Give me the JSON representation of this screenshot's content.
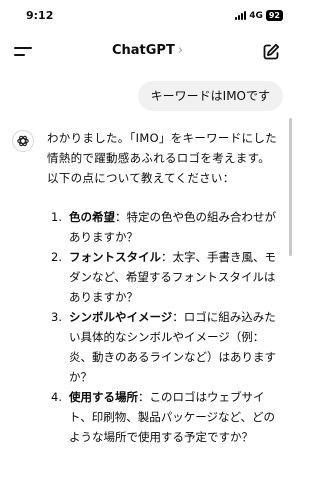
{
  "status_bar": {
    "time": "9:12",
    "network": "4G",
    "battery": "92"
  },
  "header": {
    "title": "ChatGPT",
    "title_chevron": "›",
    "menu_icon": "menu-icon",
    "compose_icon": "compose-icon"
  },
  "conversation": {
    "user_message": "キーワードはIMOです",
    "assistant_icon": "openai-logo-icon",
    "assistant_intro": "わかりました。「IMO」をキーワードにした情熱的で躍動感あふれるロゴを考えます。以下の点について教えてください：",
    "points": [
      {
        "number": "1.",
        "title": "色の希望",
        "body": "：特定の色や色の組み合わせがありますか？"
      },
      {
        "number": "2.",
        "title": "フォントスタイル",
        "body": "：太字、手書き風、モダンなど、希望するフォントスタイルはありますか？"
      },
      {
        "number": "3.",
        "title": "シンボルやイメージ",
        "body": "：ロゴに組み込みたい具体的なシンボルやイメージ（例：炎、動きのあるラインなど）はありますか？"
      },
      {
        "number": "4.",
        "title": "使用する場所",
        "body": "：このロゴはウェブサイト、印刷物、製品パッケージなど、どのような場所で使用する予定ですか？"
      }
    ]
  }
}
